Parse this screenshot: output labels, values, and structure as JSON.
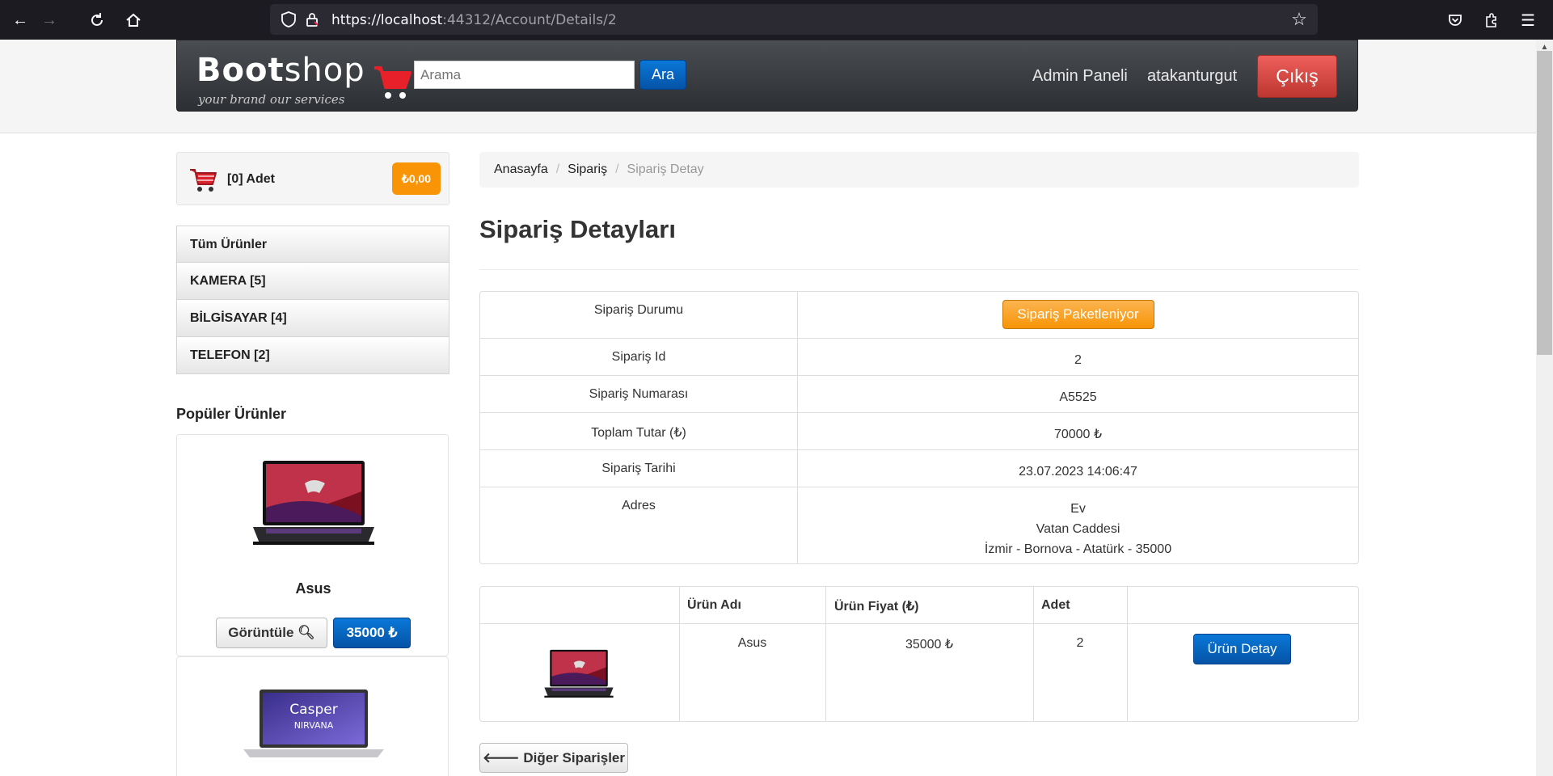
{
  "browser": {
    "url_host": "https://localhost",
    "url_rest": ":44312/Account/Details/2",
    "icons": [
      "back-icon",
      "forward-icon",
      "reload-icon",
      "home-icon",
      "shield-icon",
      "lock-icon",
      "star-icon",
      "pocket-icon",
      "extensions-icon",
      "menu-icon"
    ]
  },
  "header": {
    "logo_bold": "Boot",
    "logo_light": "shop",
    "logo_tagline": "your brand our services",
    "search_placeholder": "Arama",
    "search_button": "Ara",
    "admin_link": "Admin Paneli",
    "user_link": "atakanturgut",
    "logout_button": "Çıkış"
  },
  "sidebar": {
    "cart_label": "[0] Adet",
    "cart_total": "₺0,00",
    "categories": [
      {
        "label": "Tüm Ürünler"
      },
      {
        "label": "KAMERA [5]"
      },
      {
        "label": "BİLGİSAYAR [4]"
      },
      {
        "label": "TELEFON [2]"
      }
    ],
    "popular_title": "Popüler Ürünler",
    "products": [
      {
        "name": "Asus",
        "view_label": "Görüntüle",
        "price": "35000 ₺"
      },
      {
        "brand_text": "Casper",
        "brand_sub": "NIRVANA"
      }
    ]
  },
  "breadcrumb": {
    "items": [
      "Anasayfa",
      "Sipariş"
    ],
    "active": "Sipariş Detay"
  },
  "page_title": "Sipariş Detayları",
  "order": {
    "rows": [
      {
        "label": "Sipariş Durumu",
        "value": "Sipariş Paketleniyor"
      },
      {
        "label": "Sipariş Id",
        "value": "2"
      },
      {
        "label": "Sipariş Numarası",
        "value": "A5525"
      },
      {
        "label": "Toplam Tutar (₺)",
        "value": "70000 ₺"
      },
      {
        "label": "Sipariş Tarihi",
        "value": "23.07.2023 14:06:47"
      },
      {
        "label": "Adres",
        "value_lines": [
          "Ev",
          "Vatan Caddesi",
          "İzmir - Bornova - Atatürk - 35000"
        ]
      }
    ],
    "status_color": "#f89406"
  },
  "items": {
    "headers": [
      "Ürün Adı",
      "Ürün Fiyat (₺)",
      "Adet"
    ],
    "rows": [
      {
        "name": "Asus",
        "price": "35000 ₺",
        "qty": "2",
        "detail_button": "Ürün Detay"
      }
    ]
  },
  "back_button": "Diğer Siparişler",
  "colors": {
    "primary": "#0553a6",
    "danger": "#bd362f",
    "warning": "#f89406"
  }
}
